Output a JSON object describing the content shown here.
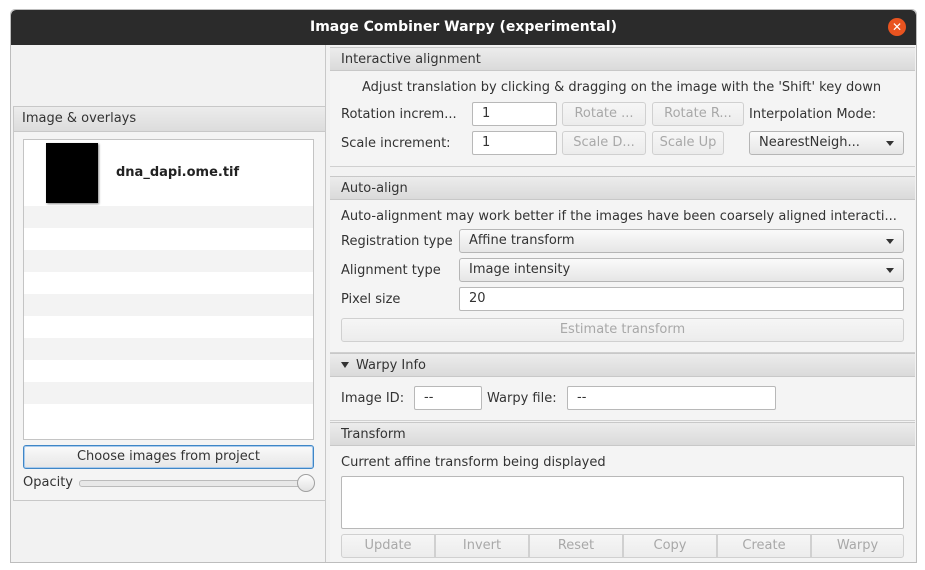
{
  "window": {
    "title": "Image Combiner Warpy (experimental)"
  },
  "left": {
    "panel_title": "Image & overlays",
    "items": [
      {
        "name": "dna_dapi.ome.tif"
      }
    ],
    "choose_button": "Choose images from project",
    "opacity_label": "Opacity",
    "opacity_value": 1.0
  },
  "interactive": {
    "title": "Interactive alignment",
    "hint": "Adjust translation by clicking & dragging on the image with the 'Shift' key down",
    "rotation_label": "Rotation increm...",
    "rotation_value": "1",
    "rotate_left": "Rotate ...",
    "rotate_right": "Rotate R...",
    "interp_label": "Interpolation Mode:",
    "scale_label": "Scale increment:",
    "scale_value": "1",
    "scale_down": "Scale D...",
    "scale_up": "Scale Up",
    "interp_value": "NearestNeigh..."
  },
  "auto": {
    "title": "Auto-align",
    "hint": "Auto-alignment may work better if the images have been coarsely aligned interacti...",
    "registration_label": "Registration type",
    "registration_value": "Affine transform",
    "alignment_label": "Alignment type",
    "alignment_value": "Image intensity",
    "pixel_label": "Pixel size",
    "pixel_value": "20",
    "estimate_button": "Estimate transform"
  },
  "warpy": {
    "title": "Warpy Info",
    "image_id_label": "Image ID:",
    "image_id_value": "--",
    "file_label": "Warpy file:",
    "file_value": "--"
  },
  "transform": {
    "title": "Transform",
    "label": "Current affine transform being displayed",
    "buttons": [
      "Update",
      "Invert",
      "Reset",
      "Copy",
      "Create",
      "Warpy"
    ]
  }
}
